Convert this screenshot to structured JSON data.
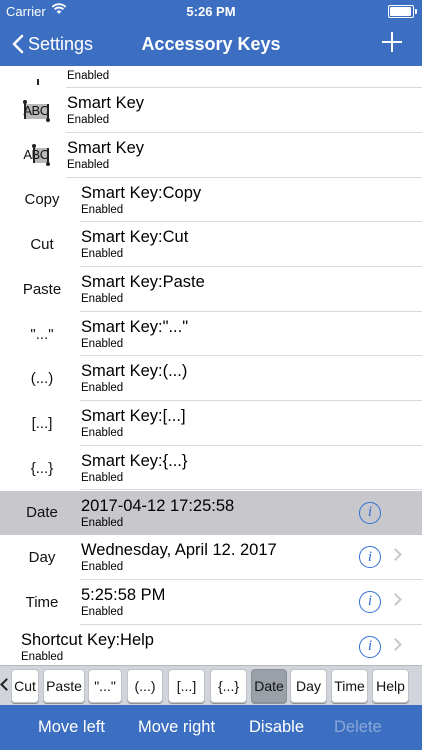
{
  "status": {
    "carrier": "Carrier",
    "time": "5:26 PM",
    "battery_level": 0.95
  },
  "nav": {
    "back_label": "Settings",
    "title": "Accessory Keys"
  },
  "rows": [
    {
      "kind": "smart",
      "icon": "partial",
      "title": "",
      "subtitle": "Enabled"
    },
    {
      "kind": "smart",
      "icon": "abc-select-all",
      "title": "Smart Key",
      "subtitle": "Enabled"
    },
    {
      "kind": "smart",
      "icon": "abc-select-part",
      "title": "Smart Key",
      "subtitle": "Enabled"
    },
    {
      "kind": "plain",
      "icon_text": "Copy",
      "title": "Smart Key:Copy",
      "subtitle": "Enabled"
    },
    {
      "kind": "plain",
      "icon_text": "Cut",
      "title": "Smart Key:Cut",
      "subtitle": "Enabled"
    },
    {
      "kind": "plain",
      "icon_text": "Paste",
      "title": "Smart Key:Paste",
      "subtitle": "Enabled"
    },
    {
      "kind": "plain",
      "icon_text": "\"...\"",
      "title": "Smart Key:\"...\"",
      "subtitle": "Enabled"
    },
    {
      "kind": "plain",
      "icon_text": "(...)",
      "title": "Smart Key:(...)",
      "subtitle": "Enabled"
    },
    {
      "kind": "plain",
      "icon_text": "[...]",
      "title": "Smart Key:[...]",
      "subtitle": "Enabled"
    },
    {
      "kind": "plain",
      "icon_text": "{...}",
      "title": "Smart Key:{...}",
      "subtitle": "Enabled"
    },
    {
      "kind": "detail",
      "icon_text": "Date",
      "title": "2017-04-12 17:25:58",
      "subtitle": "Enabled",
      "selected": true
    },
    {
      "kind": "detail",
      "icon_text": "Day",
      "title": "Wednesday, April 12. 2017",
      "subtitle": "Enabled"
    },
    {
      "kind": "detail",
      "icon_text": "Time",
      "title": "5:25:58 PM",
      "subtitle": "Enabled"
    },
    {
      "kind": "full",
      "title": "Shortcut Key:Help",
      "subtitle": "Enabled"
    }
  ],
  "keys": [
    {
      "label": "Cut"
    },
    {
      "label": "Paste"
    },
    {
      "label": "\"...\""
    },
    {
      "label": "(...)"
    },
    {
      "label": "[...]"
    },
    {
      "label": "{...}"
    },
    {
      "label": "Date",
      "active": true
    },
    {
      "label": "Day"
    },
    {
      "label": "Time"
    },
    {
      "label": "Help"
    }
  ],
  "toolbar": {
    "move_left": "Move left",
    "move_right": "Move right",
    "disable": "Disable",
    "delete": "Delete"
  },
  "colors": {
    "accent": "#3c6fc1",
    "info": "#2f6fd6",
    "selected_row": "#c7c7cc"
  }
}
